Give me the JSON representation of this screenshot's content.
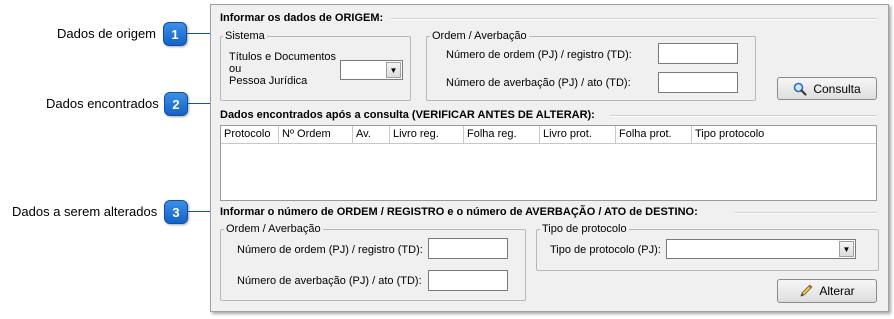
{
  "callouts": [
    {
      "label": "Dados de origem",
      "number": "1"
    },
    {
      "label": "Dados encontrados",
      "number": "2"
    },
    {
      "label": "Dados a serem alterados",
      "number": "3"
    }
  ],
  "origem": {
    "title": "Informar os dados de ORIGEM:",
    "sistema": {
      "title": "Sistema",
      "label_line1": "Títulos e Documentos",
      "label_line2": "ou",
      "label_line3": "Pessoa Jurídica",
      "value": ""
    },
    "ordem": {
      "title": "Ordem / Averbação",
      "numero_ordem_label": "Número de ordem (PJ) / registro (TD):",
      "numero_ordem_value": "",
      "numero_averbacao_label": "Número de averbação (PJ) / ato (TD):",
      "numero_averbacao_value": ""
    },
    "consulta_button": "Consulta"
  },
  "encontrados": {
    "title": "Dados encontrados após a consulta (VERIFICAR ANTES DE ALTERAR):",
    "columns": [
      "Protocolo",
      "Nº Ordem",
      "Av.",
      "Livro reg.",
      "Folha reg.",
      "Livro prot.",
      "Folha prot.",
      "Tipo protocolo"
    ]
  },
  "destino": {
    "title": "Informar o número de ORDEM / REGISTRO e o número de AVERBAÇÃO / ATO de DESTINO:",
    "ordem": {
      "title": "Ordem / Averbação",
      "numero_ordem_label": "Número de ordem (PJ) / registro (TD):",
      "numero_ordem_value": "",
      "numero_averbacao_label": "Número de averbação (PJ) / ato (TD):",
      "numero_averbacao_value": ""
    },
    "tipo": {
      "title": "Tipo de protocolo",
      "label": "Tipo de protocolo (PJ):",
      "value": ""
    },
    "alterar_button": "Alterar"
  },
  "colors": {
    "callout": "#1462c6",
    "panel_bg": "#f0f0f0"
  }
}
